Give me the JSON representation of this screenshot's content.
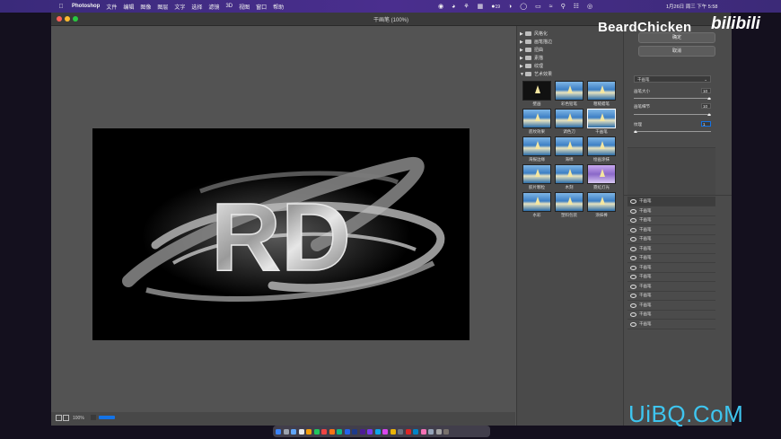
{
  "menubar": {
    "app_name": "Photoshop",
    "items": [
      "文件",
      "编辑",
      "图像",
      "图层",
      "文字",
      "选择",
      "滤镜",
      "3D",
      "视图",
      "窗口",
      "帮助"
    ],
    "battery": "19",
    "clock": "1月26日 周三 下午 5:58"
  },
  "window": {
    "title": "干画笔 (100%)"
  },
  "canvas": {
    "text": "RD"
  },
  "statusbar": {
    "zoom": "100%"
  },
  "filter_gallery": {
    "categories": [
      {
        "label": "风格化",
        "expanded": false
      },
      {
        "label": "画笔描边",
        "expanded": false
      },
      {
        "label": "扭曲",
        "expanded": false
      },
      {
        "label": "素描",
        "expanded": false
      },
      {
        "label": "纹理",
        "expanded": false
      },
      {
        "label": "艺术效果",
        "expanded": true
      }
    ],
    "thumbs": [
      {
        "label": "壁画"
      },
      {
        "label": "彩色铅笔"
      },
      {
        "label": "粗糙蜡笔"
      },
      {
        "label": "底纹效果"
      },
      {
        "label": "调色刀"
      },
      {
        "label": "干画笔",
        "selected": true
      },
      {
        "label": "海报边缘"
      },
      {
        "label": "海绵"
      },
      {
        "label": "绘画涂抹"
      },
      {
        "label": "胶片颗粒"
      },
      {
        "label": "木刻"
      },
      {
        "label": "霓虹灯光"
      },
      {
        "label": "水彩"
      },
      {
        "label": "塑料包装"
      },
      {
        "label": "涂抹棒"
      }
    ]
  },
  "settings": {
    "ok_label": "确定",
    "cancel_label": "取消",
    "filter_select": "干画笔",
    "params": [
      {
        "label": "画笔大小",
        "value": "10",
        "fraction": 1.0
      },
      {
        "label": "画笔细节",
        "value": "10",
        "fraction": 1.0
      },
      {
        "label": "纹理",
        "value": "1",
        "fraction": 0.0
      }
    ],
    "layers": [
      "干画笔",
      "干画笔",
      "干画笔",
      "干画笔",
      "干画笔",
      "干画笔",
      "干画笔",
      "干画笔",
      "干画笔",
      "干画笔",
      "干画笔",
      "干画笔",
      "干画笔",
      "干画笔"
    ]
  },
  "watermarks": {
    "top": "BeardChicken",
    "bili": "bilibili",
    "bottom": "UiBQ.CoM"
  },
  "colors": {
    "menubar": "#4a2e8e",
    "accent_blue": "#1473e6",
    "watermark_blue": "#3ec5ef"
  }
}
